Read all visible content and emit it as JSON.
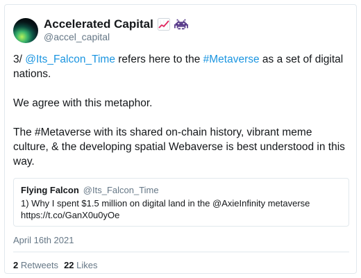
{
  "author": {
    "display_name": "Accelerated Capital",
    "handle": "@accel_capital",
    "emojis": [
      "chart-increasing-emoji",
      "space-invader-emoji"
    ]
  },
  "tweet": {
    "line1_prefix": "3/ ",
    "mention": "@Its_Falcon_Time",
    "line1_mid": " refers here to the ",
    "hashtag": "#Metaverse",
    "line1_suffix": " as a set of digital nations.",
    "paragraph2": "We agree with this metaphor.",
    "paragraph3": "The #Metaverse with its shared on-chain history, vibrant meme culture, & the developing spatial Webaverse is best understood in this way."
  },
  "quoted_tweet": {
    "name": "Flying Falcon",
    "handle": "@Its_Falcon_Time",
    "text_line1": "1) Why I spent $1.5 million on digital land in the @AxieInfinity metaverse",
    "text_line2": "https://t.co/GanX0u0yOe"
  },
  "date": "April 16th 2021",
  "stats": {
    "retweets_count": "2",
    "retweets_label": "Retweets",
    "likes_count": "22",
    "likes_label": "Likes"
  },
  "colors": {
    "link": "#1b95e0",
    "muted": "#657786",
    "border": "#e1e8ed"
  }
}
